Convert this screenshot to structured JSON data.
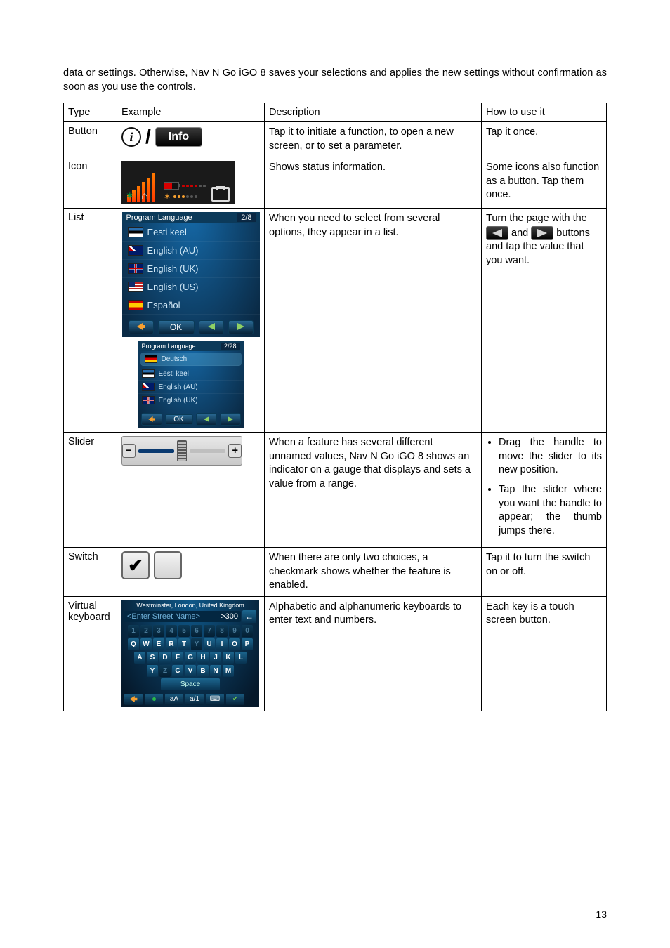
{
  "intro": "data or settings. Otherwise, Nav N Go iGO 8 saves your selections and applies the new settings without confirmation as soon as you use the controls.",
  "headers": {
    "type": "Type",
    "example": "Example",
    "description": "Description",
    "howto": "How to use it"
  },
  "rows": {
    "button": {
      "type": "Button",
      "ex": {
        "info_label": "Info",
        "icon_letter": "i"
      },
      "desc": "Tap it to initiate a function, to open a new screen, or to set a parameter.",
      "howto": "Tap it once."
    },
    "icon": {
      "type": "Icon",
      "desc": "Shows status information.",
      "howto": "Some icons also function as a button. Tap them once."
    },
    "list": {
      "type": "List",
      "ex": {
        "title": "Program Language",
        "page_big": "2/8",
        "page_small": "2/28",
        "items_big": [
          "Eesti keel",
          "English (AU)",
          "English (UK)",
          "English (US)",
          "Español"
        ],
        "items_small": [
          "Deutsch",
          "Eesti keel",
          "English (AU)",
          "English (UK)"
        ],
        "ok": "OK"
      },
      "desc": "When you need to select from several options, they appear in a list.",
      "howto_pre": "Turn the page with the ",
      "howto_mid": " and ",
      "howto_post": " buttons and tap the value that you want."
    },
    "slider": {
      "type": "Slider",
      "desc": "When a feature has several different unnamed values, Nav N Go iGO 8 shows an indicator on a gauge that displays and sets a value from a range.",
      "howto_b1": "Drag the handle to move the slider to its new position.",
      "howto_b2": "Tap the slider where you want the handle to appear; the thumb jumps there."
    },
    "switch": {
      "type": "Switch",
      "desc": "When there are only two choices, a checkmark shows whether the feature is enabled.",
      "howto": "Tap it to turn the switch on or off."
    },
    "vk": {
      "type": "Virtual keyboard",
      "ex": {
        "header": "Westminster, London, United Kingdom",
        "placeholder": "<Enter Street Name>",
        "count": ">300",
        "row1": [
          "1",
          "2",
          "3",
          "4",
          "5",
          "6",
          "7",
          "8",
          "9",
          "0"
        ],
        "row2": [
          "Q",
          "W",
          "E",
          "R",
          "T",
          "Y",
          "U",
          "I",
          "O",
          "P"
        ],
        "row3": [
          "A",
          "S",
          "D",
          "F",
          "G",
          "H",
          "J",
          "K",
          "L"
        ],
        "row4": [
          "Y",
          "Z",
          "C",
          "V",
          "B",
          "N",
          "M"
        ],
        "space": "Space",
        "foot": {
          "shift": "aA",
          "mode": "a/1"
        }
      },
      "desc": "Alphabetic and alphanumeric keyboards to enter text and numbers.",
      "howto": "Each key is a touch screen button."
    }
  },
  "page_number": "13"
}
